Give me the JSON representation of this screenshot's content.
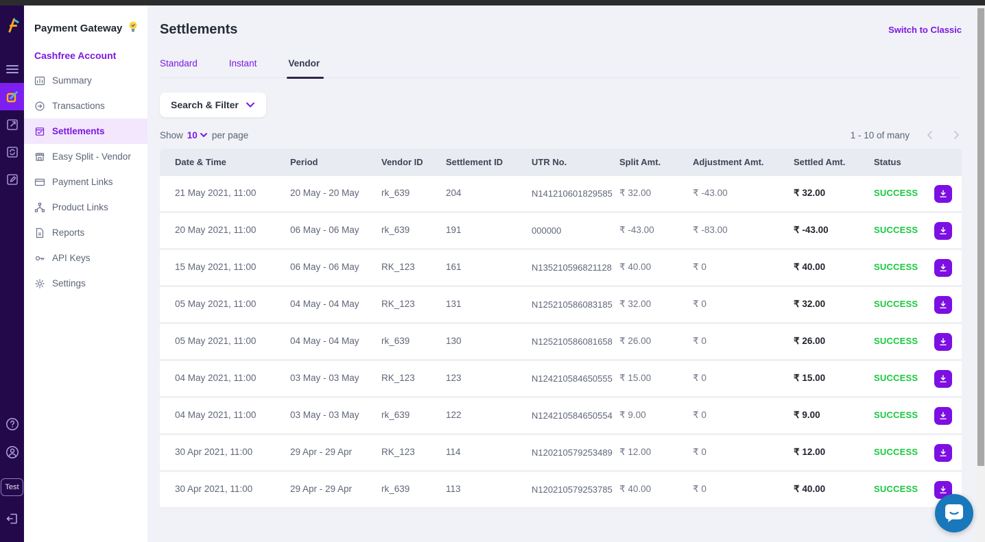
{
  "colors": {
    "accent_purple": "#7d17e0",
    "rail_bg": "#23094a",
    "rail_active_bg": "#7c1ff0",
    "sidebar_active_bg": "#f2e7fd",
    "success_green": "#17c93d",
    "download_btn": "#7c0fe2",
    "chat_blue": "#1878bb",
    "header_row_bg": "#e9ebf2",
    "main_bg": "#f0f2f7",
    "topbar_bg": "#2c2c2e"
  },
  "rail": {
    "test_label": "Test"
  },
  "sidebar": {
    "product_title": "Payment Gateway",
    "account_name": "Cashfree Account",
    "items": [
      {
        "label": "Summary"
      },
      {
        "label": "Transactions"
      },
      {
        "label": "Settlements",
        "active": true
      },
      {
        "label": "Easy Split - Vendor"
      },
      {
        "label": "Payment Links"
      },
      {
        "label": "Product Links"
      },
      {
        "label": "Reports"
      },
      {
        "label": "API Keys"
      },
      {
        "label": "Settings"
      }
    ]
  },
  "header": {
    "page_title": "Settlements",
    "switch_to_classic": "Switch to Classic"
  },
  "tabs": [
    {
      "label": "Standard",
      "active": false
    },
    {
      "label": "Instant",
      "active": false
    },
    {
      "label": "Vendor",
      "active": true
    }
  ],
  "controls": {
    "search_filter_label": "Search & Filter",
    "show_label": "Show",
    "page_size": "10",
    "per_page_label": "per page",
    "pagination_text": "1 - 10 of many"
  },
  "table": {
    "columns": [
      "Date & Time",
      "Period",
      "Vendor ID",
      "Settlement ID",
      "UTR No.",
      "Split Amt.",
      "Adjustment Amt.",
      "Settled Amt.",
      "Status"
    ],
    "rows": [
      {
        "date_time": "21 May 2021, 11:00",
        "period": "20 May - 20 May",
        "vendor_id": "rk_639",
        "settlement_id": "204",
        "utr_no": "N141210601829585",
        "split_amt": "₹ 32.00",
        "adjustment_amt": "₹ -43.00",
        "settled_amt": "₹ 32.00",
        "status": "SUCCESS"
      },
      {
        "date_time": "20 May 2021, 11:00",
        "period": "06 May - 06 May",
        "vendor_id": "rk_639",
        "settlement_id": "191",
        "utr_no": "000000",
        "split_amt": "₹ -43.00",
        "adjustment_amt": "₹ -83.00",
        "settled_amt": "₹ -43.00",
        "status": "SUCCESS"
      },
      {
        "date_time": "15 May 2021, 11:00",
        "period": "06 May - 06 May",
        "vendor_id": "RK_123",
        "settlement_id": "161",
        "utr_no": "N135210596821128",
        "split_amt": "₹ 40.00",
        "adjustment_amt": "₹ 0",
        "settled_amt": "₹ 40.00",
        "status": "SUCCESS"
      },
      {
        "date_time": "05 May 2021, 11:00",
        "period": "04 May - 04 May",
        "vendor_id": "RK_123",
        "settlement_id": "131",
        "utr_no": "N125210586083185",
        "split_amt": "₹ 32.00",
        "adjustment_amt": "₹ 0",
        "settled_amt": "₹ 32.00",
        "status": "SUCCESS"
      },
      {
        "date_time": "05 May 2021, 11:00",
        "period": "04 May - 04 May",
        "vendor_id": "rk_639",
        "settlement_id": "130",
        "utr_no": "N125210586081658",
        "split_amt": "₹ 26.00",
        "adjustment_amt": "₹ 0",
        "settled_amt": "₹ 26.00",
        "status": "SUCCESS"
      },
      {
        "date_time": "04 May 2021, 11:00",
        "period": "03 May - 03 May",
        "vendor_id": "RK_123",
        "settlement_id": "123",
        "utr_no": "N124210584650555",
        "split_amt": "₹ 15.00",
        "adjustment_amt": "₹ 0",
        "settled_amt": "₹ 15.00",
        "status": "SUCCESS"
      },
      {
        "date_time": "04 May 2021, 11:00",
        "period": "03 May - 03 May",
        "vendor_id": "rk_639",
        "settlement_id": "122",
        "utr_no": "N124210584650554",
        "split_amt": "₹ 9.00",
        "adjustment_amt": "₹ 0",
        "settled_amt": "₹ 9.00",
        "status": "SUCCESS"
      },
      {
        "date_time": "30 Apr 2021, 11:00",
        "period": "29 Apr - 29 Apr",
        "vendor_id": "RK_123",
        "settlement_id": "114",
        "utr_no": "N120210579253489",
        "split_amt": "₹ 12.00",
        "adjustment_amt": "₹ 0",
        "settled_amt": "₹ 12.00",
        "status": "SUCCESS"
      },
      {
        "date_time": "30 Apr 2021, 11:00",
        "period": "29 Apr - 29 Apr",
        "vendor_id": "rk_639",
        "settlement_id": "113",
        "utr_no": "N120210579253785",
        "split_amt": "₹ 40.00",
        "adjustment_amt": "₹ 0",
        "settled_amt": "₹ 40.00",
        "status": "SUCCESS"
      }
    ]
  }
}
